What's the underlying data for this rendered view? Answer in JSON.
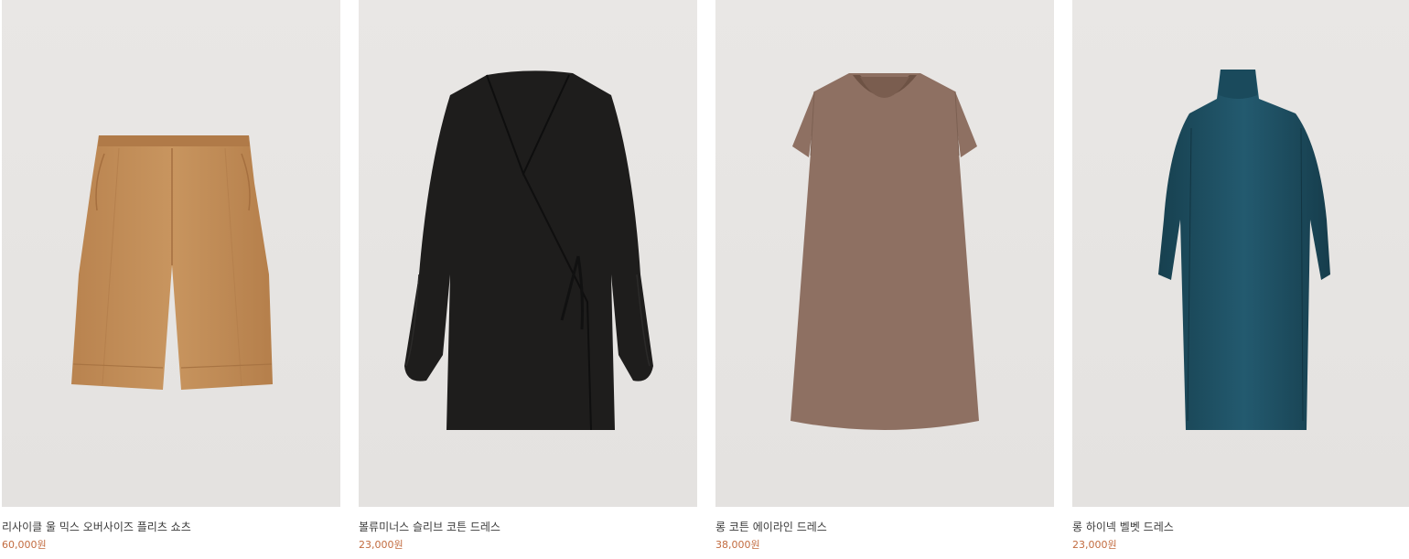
{
  "products": [
    {
      "name": "리사이클 울 믹스 오버사이즈 플리츠 쇼츠",
      "price": "60,000원",
      "image_alt": "camel shorts",
      "garment_color": "#c6925c"
    },
    {
      "name": "볼류미너스 슬리브 코튼 드레스",
      "price": "23,000원",
      "image_alt": "black wrap dress",
      "garment_color": "#1c1b1a"
    },
    {
      "name": "롱 코튼 에이라인 드레스",
      "price": "38,000원",
      "image_alt": "brown a-line dress",
      "garment_color": "#8e7062"
    },
    {
      "name": "롱 하이넥 벨벳 드레스",
      "price": "23,000원",
      "image_alt": "teal velvet high-neck dress",
      "garment_color": "#1f4f62"
    }
  ],
  "colors": {
    "background": "#ffffff",
    "photo_bg": "#e6e4e2",
    "name_text": "#3a3a3a",
    "price_text": "#c26b3f"
  }
}
